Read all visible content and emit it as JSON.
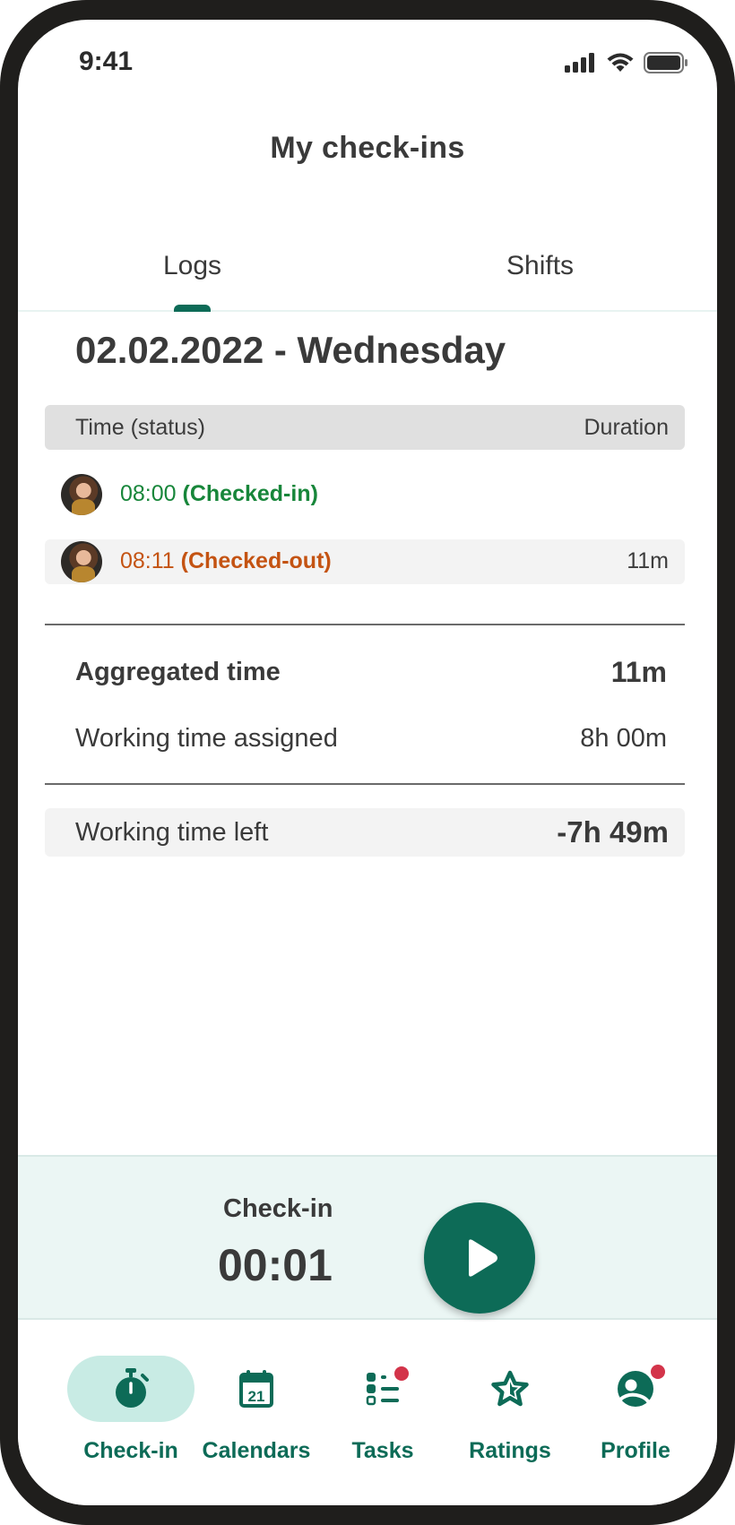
{
  "status_bar": {
    "time": "9:41",
    "icons": [
      "signal-icon",
      "wifi-icon",
      "battery-icon"
    ]
  },
  "header": {
    "title": "My check-ins"
  },
  "tabs": [
    {
      "label": "Logs",
      "active": true
    },
    {
      "label": "Shifts",
      "active": false
    }
  ],
  "day": {
    "date_heading": "02.02.2022 - Wednesday"
  },
  "table": {
    "header_left": "Time (status)",
    "header_right": "Duration",
    "rows": [
      {
        "time": "08:00",
        "status": "(Checked-in)",
        "duration": "",
        "color": "#17863a"
      },
      {
        "time": "08:11",
        "status": "(Checked-out)",
        "duration": "11m",
        "color": "#c45312"
      }
    ]
  },
  "summary": {
    "aggregated_label": "Aggregated time",
    "aggregated_value": "11m",
    "assigned_label": "Working time assigned",
    "assigned_value": "8h 00m",
    "left_label": "Working time left",
    "left_value": "-7h 49m"
  },
  "checkin_panel": {
    "label": "Check-in",
    "timer": "00:01",
    "action_icon": "play-icon"
  },
  "bottom_nav": [
    {
      "label": "Check-in",
      "icon": "stopwatch-icon",
      "active": true,
      "badge": false
    },
    {
      "label": "Calendars",
      "icon": "calendar-icon",
      "active": false,
      "badge": false,
      "icon_text": "21"
    },
    {
      "label": "Tasks",
      "icon": "task-list-icon",
      "active": false,
      "badge": true
    },
    {
      "label": "Ratings",
      "icon": "star-icon",
      "active": false,
      "badge": false
    },
    {
      "label": "Profile",
      "icon": "profile-icon",
      "active": false,
      "badge": true
    }
  ],
  "colors": {
    "accent": "#0d6b57",
    "checked_in": "#17863a",
    "checked_out": "#c45312",
    "badge": "#d3344a",
    "panel_bg": "#ebf6f4"
  }
}
